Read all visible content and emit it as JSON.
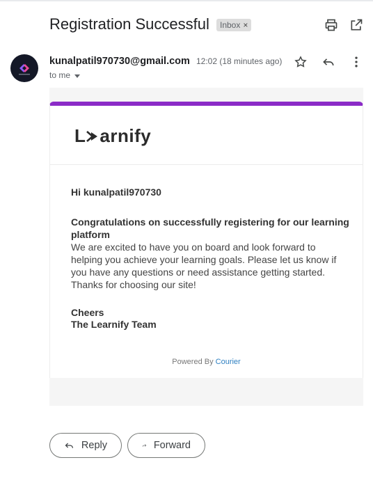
{
  "subject": "Registration Successful",
  "labels": {
    "inbox": "Inbox",
    "remove": "×"
  },
  "header_icons": [
    "print-icon",
    "open-in-new-window-icon"
  ],
  "sender": {
    "email": "kunalpatil970730@gmail.com",
    "time": "12:02 (18 minutes ago)",
    "to": "to me"
  },
  "message_actions": [
    "star-icon",
    "reply-icon",
    "more-vert-icon"
  ],
  "email": {
    "brand": {
      "prefix": "L",
      "suffix": "arnify"
    },
    "greeting": "Hi kunalpatil970730",
    "headline": "Congratulations on successfully registering for our learning platform",
    "body": "We are excited to have you on board and look forward to helping you achieve your learning goals. Please let us know if you have any questions or need assistance getting started. Thanks for choosing our site!",
    "signoff_1": "Cheers",
    "signoff_2": "The Learnify Team",
    "powered_prefix": "Powered By",
    "powered_link": "Courier",
    "accent_color": "#8b2bc7"
  },
  "actions": {
    "reply": "Reply",
    "forward": "Forward"
  }
}
